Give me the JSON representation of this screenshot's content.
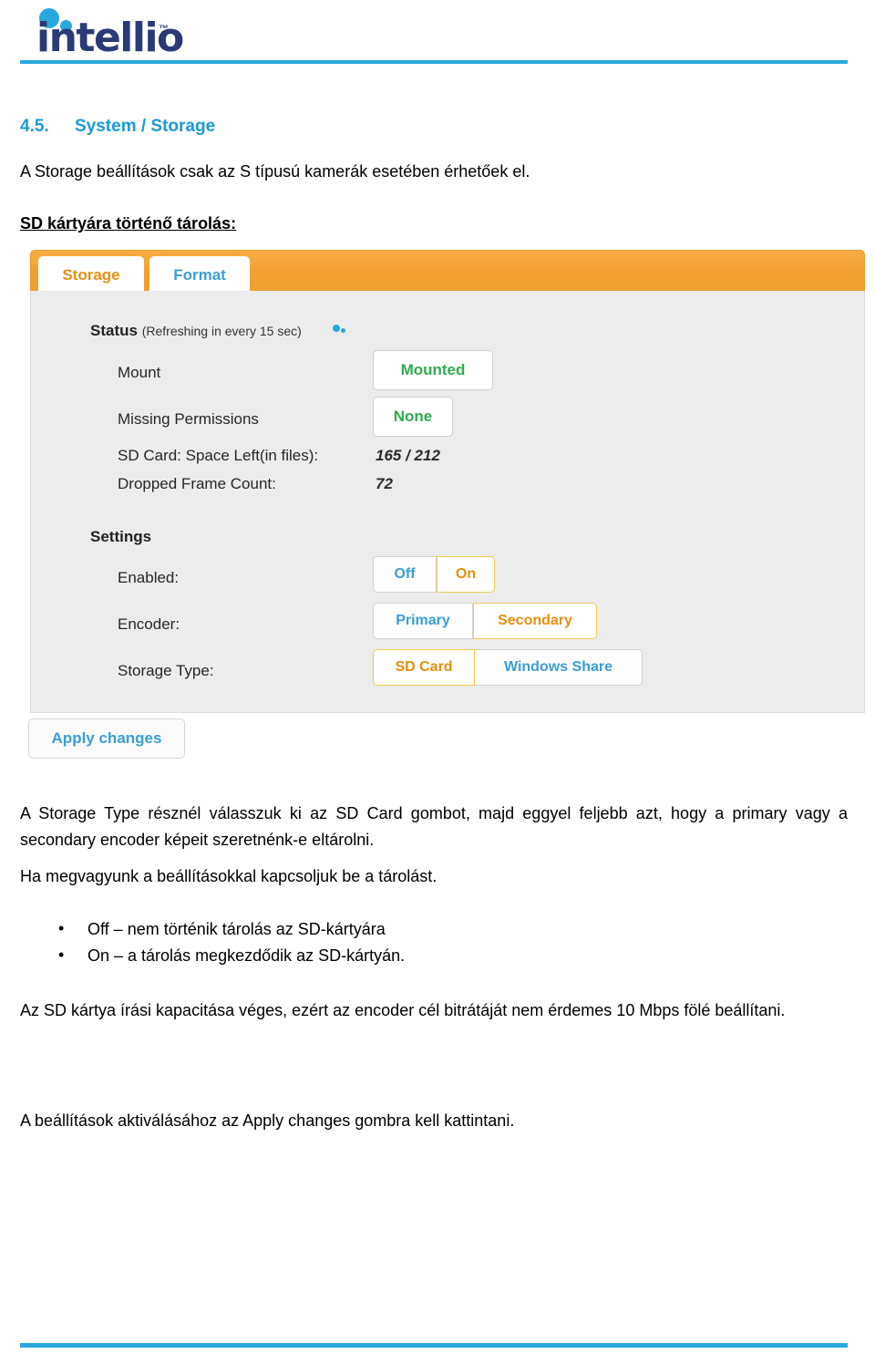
{
  "header": {
    "logo_text": "intellio",
    "logo_tm": "™",
    "logo_dot_color": "#29a8df",
    "logo_word_color": "#2b3a77",
    "rule_color": "#29a8df"
  },
  "section": {
    "number": "4.5.",
    "title": "System / Storage",
    "title_color": "#1c9ad6",
    "intro": "A Storage beállítások csak az S típusú kamerák esetében érhetőek el.",
    "subheading": "SD kártyára történő tárolás:"
  },
  "screenshot": {
    "tabs": [
      {
        "label": "Storage",
        "active": true,
        "color": "#e6900f"
      },
      {
        "label": "Format",
        "active": false,
        "color": "#3b9ed4"
      }
    ],
    "tabbar_color": "#f2a030",
    "panel_bg": "#ececec",
    "status": {
      "title": "Status",
      "note": "(Refreshing in every 15 sec)",
      "spinner_icon": "loading-dots-icon",
      "rows": [
        {
          "label": "Mount",
          "value": "Mounted",
          "kind": "pill",
          "value_color": "#2fab4e"
        },
        {
          "label": "Missing Permissions",
          "value": "None",
          "kind": "pill",
          "value_color": "#2fab4e"
        },
        {
          "label": "SD Card: Space Left(in files):",
          "value": "165 / 212",
          "kind": "text"
        },
        {
          "label": "Dropped Frame Count:",
          "value": "72",
          "kind": "text"
        }
      ]
    },
    "settings": {
      "title": "Settings",
      "rows": [
        {
          "label": "Enabled:",
          "options": [
            {
              "label": "Off",
              "selected": false
            },
            {
              "label": "On",
              "selected": true
            }
          ]
        },
        {
          "label": "Encoder:",
          "options": [
            {
              "label": "Primary",
              "selected": false
            },
            {
              "label": "Secondary",
              "selected": true
            }
          ]
        },
        {
          "label": "Storage Type:",
          "options": [
            {
              "label": "SD Card",
              "selected": true
            },
            {
              "label": "Windows Share",
              "selected": false
            }
          ]
        }
      ],
      "selected_border_color": "#f0cb50",
      "selected_text_color": "#e6900f",
      "unselected_text_color": "#3b9ed4"
    },
    "apply_button": "Apply changes"
  },
  "body": {
    "paragraph_1": "A Storage Type résznél válasszuk ki az SD Card gombot, majd eggyel feljebb azt, hogy a primary vagy a secondary encoder képeit szeretnénk-e eltárolni.",
    "paragraph_2": "Ha megvagyunk a beállításokkal kapcsoljuk be a tárolást.",
    "bullets": [
      "Off – nem történik tárolás az SD-kártyára",
      "On – a tárolás megkezdődik az SD-kártyán."
    ],
    "paragraph_3": "Az SD kártya írási kapacitása véges, ezért az encoder cél bitrátáját nem érdemes 10 Mbps fölé beállítani.",
    "paragraph_4": "A beállítások aktiválásához az Apply changes gombra kell kattintani."
  },
  "footer": {
    "rule_color": "#29a8df"
  }
}
